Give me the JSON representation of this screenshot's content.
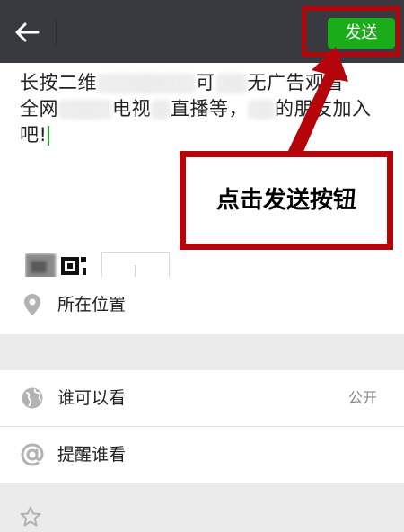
{
  "header": {
    "send_label": "发送"
  },
  "compose": {
    "text_line1_a": "长按二维",
    "text_line1_b": "可",
    "text_line1_c": "无广告观看",
    "text_line2_a": "全网",
    "text_line2_b": "电视",
    "text_line2_c": "直播等，",
    "text_line2_d": "的朋友加入",
    "text_line3": "吧!"
  },
  "options": {
    "location_label": "所在位置",
    "visibility_label": "谁可以看",
    "visibility_value": "公开",
    "mention_label": "提醒谁看"
  },
  "annotation": {
    "callout_text": "点击发送按钮",
    "color": "#b5050b"
  },
  "colors": {
    "topbar": "#393a3f",
    "send_button": "#1aad19",
    "background": "#ebebeb"
  },
  "icons": [
    "back-arrow-icon",
    "location-pin-icon",
    "globe-icon",
    "at-sign-icon",
    "star-icon",
    "plus-icon"
  ]
}
